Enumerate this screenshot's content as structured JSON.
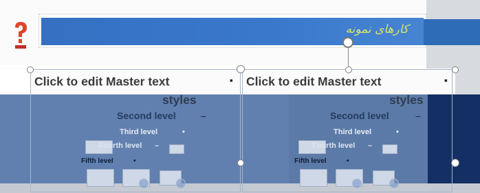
{
  "slide": {
    "title_text": "کارهای نمونه",
    "left_placeholder": {
      "level1": "Click to edit Master text",
      "level1_cont": "styles",
      "level2": "Second level",
      "level3": "Third level",
      "level4": "Fourth level",
      "level5": "Fifth level"
    },
    "right_placeholder": {
      "level1": "Click to edit Master text",
      "level1_cont": "styles",
      "level2": "Second level",
      "level3": "Third level",
      "level4": "Fourth level",
      "level5": "Fifth level"
    },
    "bullets": {
      "square": "▪",
      "dash": "–",
      "dot": "•"
    }
  },
  "colors": {
    "title_bar": "#3570c2",
    "body_background": "#173a78",
    "logo_red": "#e0422b",
    "title_text": "#d8e36a"
  },
  "icons": [
    "app-logo-icon",
    "rotation-handle-icon",
    "resize-handle-icon"
  ]
}
